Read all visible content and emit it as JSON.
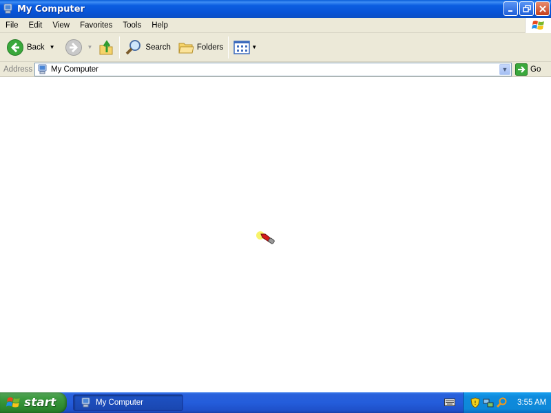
{
  "window": {
    "title": "My Computer",
    "controls": [
      "minimize",
      "restore",
      "close"
    ]
  },
  "menu": [
    "File",
    "Edit",
    "View",
    "Favorites",
    "Tools",
    "Help"
  ],
  "toolbar": {
    "back_label": "Back",
    "search_label": "Search",
    "folders_label": "Folders"
  },
  "address": {
    "label": "Address",
    "value": "My Computer",
    "go_label": "Go"
  },
  "taskbar": {
    "start_label": "start",
    "task_label": "My Computer",
    "clock": "3:55 AM"
  },
  "colors": {
    "titlebar": "#0853d6",
    "chrome": "#ece9d8",
    "taskbar": "#245ddb",
    "start": "#3c9a3f",
    "tray": "#0f8bdd"
  }
}
